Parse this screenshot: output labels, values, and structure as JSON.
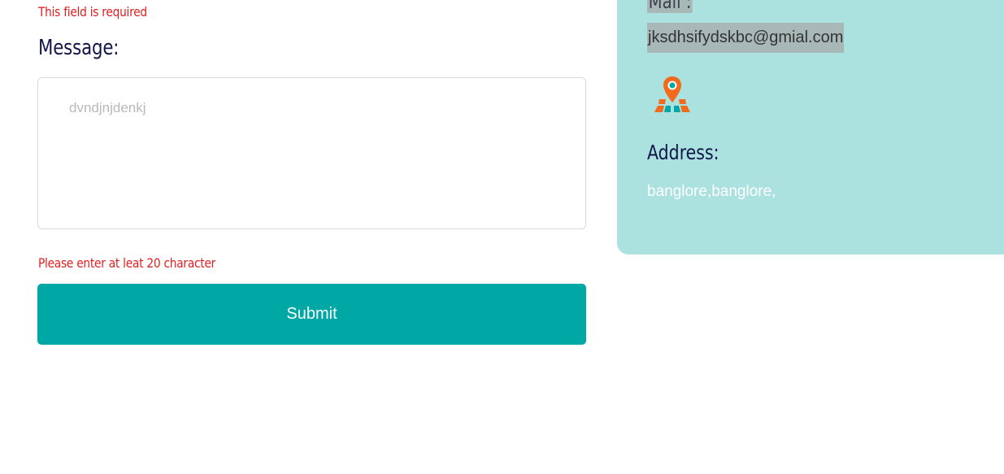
{
  "form": {
    "top_error": "This field is required",
    "message_label": "Message:",
    "message_placeholder": "dvndjnjdenkj",
    "message_error": "Please enter at leat 20 character",
    "submit_label": "Submit"
  },
  "contact": {
    "mail_label": "Mail :",
    "email": "jksdhsifydskbc@gmial.com",
    "map_icon": "map-pin-icon",
    "address_label": "Address:",
    "address": "banglore,banglore,"
  },
  "colors": {
    "error": "#e02020",
    "heading": "#12174a",
    "submit_bg": "#00a8a5",
    "panel_bg": "#abe1df",
    "highlight": "#a8b8b6",
    "icon_orange": "#f26a1b",
    "icon_teal": "#00a8a5"
  }
}
